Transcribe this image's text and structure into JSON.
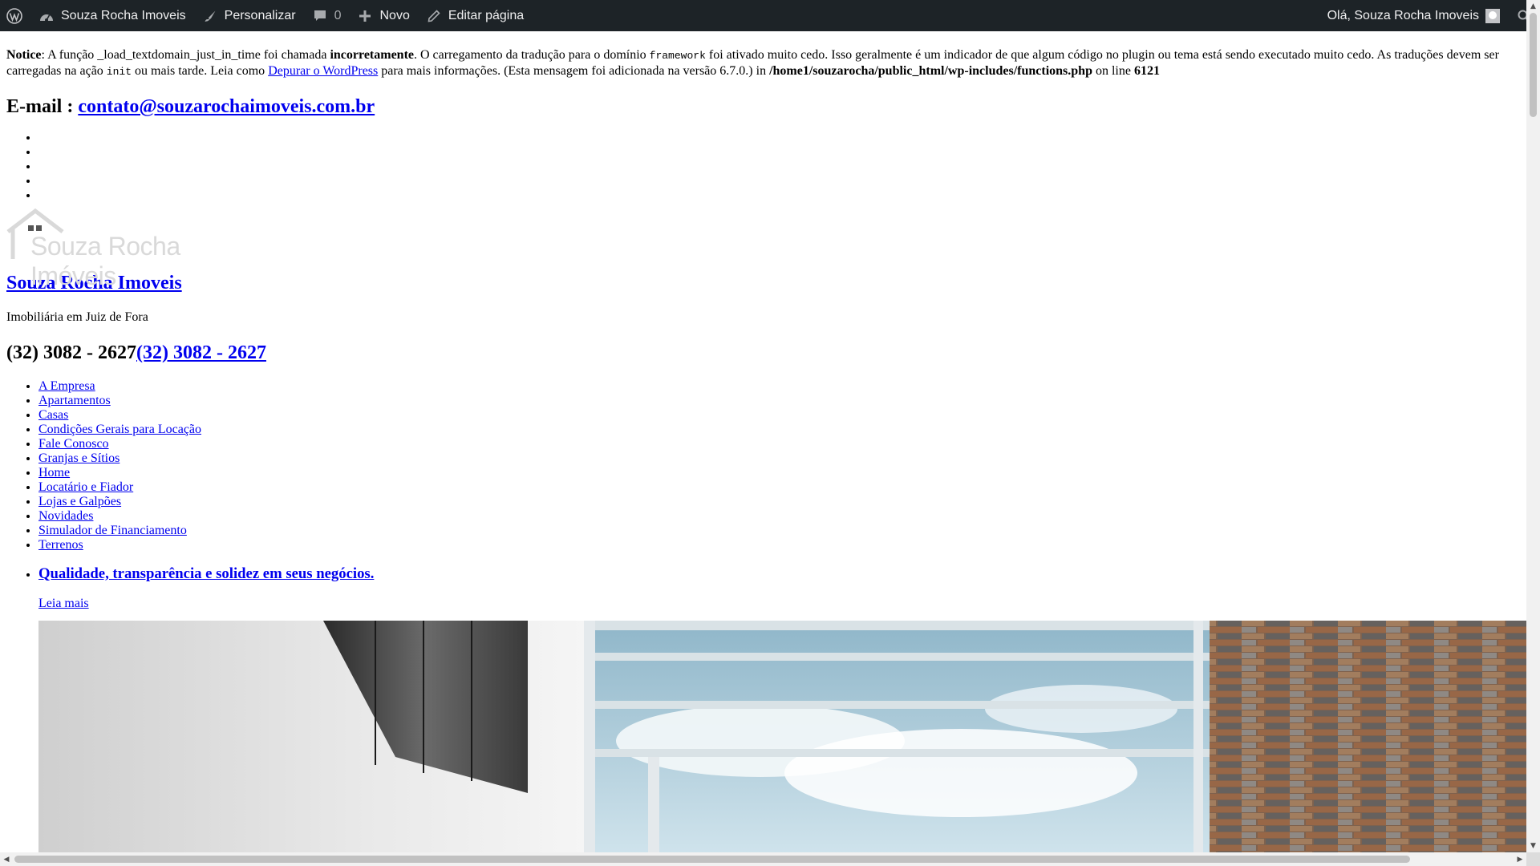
{
  "adminbar": {
    "site_name": "Souza Rocha Imoveis",
    "customize": "Personalizar",
    "comments_count": "0",
    "new": "Novo",
    "edit_page": "Editar página",
    "greeting": "Olá, Souza Rocha Imoveis"
  },
  "notice": {
    "label": "Notice",
    "t1": ": A função _load_textdomain_just_in_time foi chamada ",
    "strong1": "incorretamente",
    "t2": ". O carregamento da tradução para o domínio ",
    "code1": "framework",
    "t3": " foi ativado muito cedo. Isso geralmente é um indicador de que algum código no plugin ou tema está sendo executado muito cedo. As traduções devem ser carregadas na ação ",
    "code2": "init",
    "t4": " ou mais tarde. Leia como ",
    "link": "Depurar o WordPress",
    "t5": " para mais informações. (Esta mensagem foi adicionada na versão 6.7.0.) in ",
    "path": "/home1/souzarocha/public_html/wp-includes/functions.php",
    "t6": " on line ",
    "line": "6121"
  },
  "email": {
    "label": "E-mail : ",
    "address": "contato@souzarochaimoveis.com.br"
  },
  "logo": {
    "text": "Souza Rocha Imóveis"
  },
  "site_title": "Souza Rocha Imoveis",
  "tagline": "Imobiliária em Juiz de Fora",
  "phone": {
    "text": "(32) 3082 - 2627",
    "link": "(32) 3082 - 2627"
  },
  "menu": [
    "A Empresa",
    "Apartamentos",
    "Casas",
    "Condições Gerais para Locação",
    "Fale Conosco",
    "Granjas e Sítios",
    "Home",
    "Locatário e Fiador",
    "Lojas e Galpões",
    "Novidades",
    "Simulador de Financiamento",
    "Terrenos"
  ],
  "slide": {
    "title": "Qualidade, transparência e solidez em seus negócios.",
    "read_more": "Leia mais"
  }
}
